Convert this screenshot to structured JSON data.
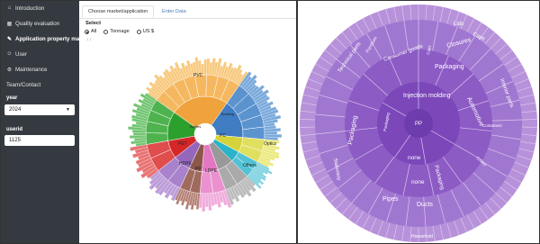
{
  "sidebar": {
    "items": [
      {
        "label": "Introduction",
        "icon": "home-icon"
      },
      {
        "label": "Quality evaluation",
        "icon": "table-icon"
      },
      {
        "label": "Application property matrix",
        "icon": "pencil-icon"
      },
      {
        "label": "User",
        "icon": "user-icon"
      },
      {
        "label": "Maintenance",
        "icon": "wrench-icon"
      },
      {
        "label": "Team/Contact",
        "icon": "none"
      }
    ],
    "active_index": 2,
    "year_label": "year",
    "year_value": "2024",
    "userid_label": "userid",
    "userid_value": "1125"
  },
  "tabs": [
    {
      "label": "Choose market/application",
      "active": true
    },
    {
      "label": "Enter Data",
      "active": false
    }
  ],
  "select": {
    "label": "Select",
    "options": [
      "All",
      "Tonnage",
      "US $"
    ],
    "selected": "All",
    "tiny_text": "1 1"
  },
  "left_sunburst_labels": {
    "PVC": "PVC",
    "PC": "PC",
    "PET": "PET",
    "HDPE": "HDPE",
    "PP": "PP",
    "LDPE": "LDPE",
    "Others": "Others",
    "Optics": "Optics",
    "Bottles": "Bottles",
    "Building": "Building"
  },
  "right_sunburst_labels": {
    "center": "PP",
    "injection": "Injection molding",
    "none1": "none",
    "none2": "none",
    "packaging": "Packaging",
    "automotive": "Automotive",
    "packaging2": "Packaging",
    "packaging3": "Packaging",
    "consumer": "Consumer goods",
    "technical": "Technical parts",
    "furniture": "Furniture",
    "closures": "Closures",
    "caps": "Caps",
    "lids": "Lids",
    "interior": "Interior parts",
    "stationery": "Stationery",
    "pipes": "Pipes",
    "ducts": "Ducts",
    "household": "Household",
    "packaging_inner": "Packaging",
    "containers": "Containers",
    "crates": "Crates",
    "caps2": "Caps"
  },
  "colors": {
    "sidebar_bg": "#343a40",
    "right_outer": "#b28fd6",
    "right_mid": "#9b6bcc",
    "right_inner": "#8a57c2",
    "right_core": "#7b45b8"
  }
}
